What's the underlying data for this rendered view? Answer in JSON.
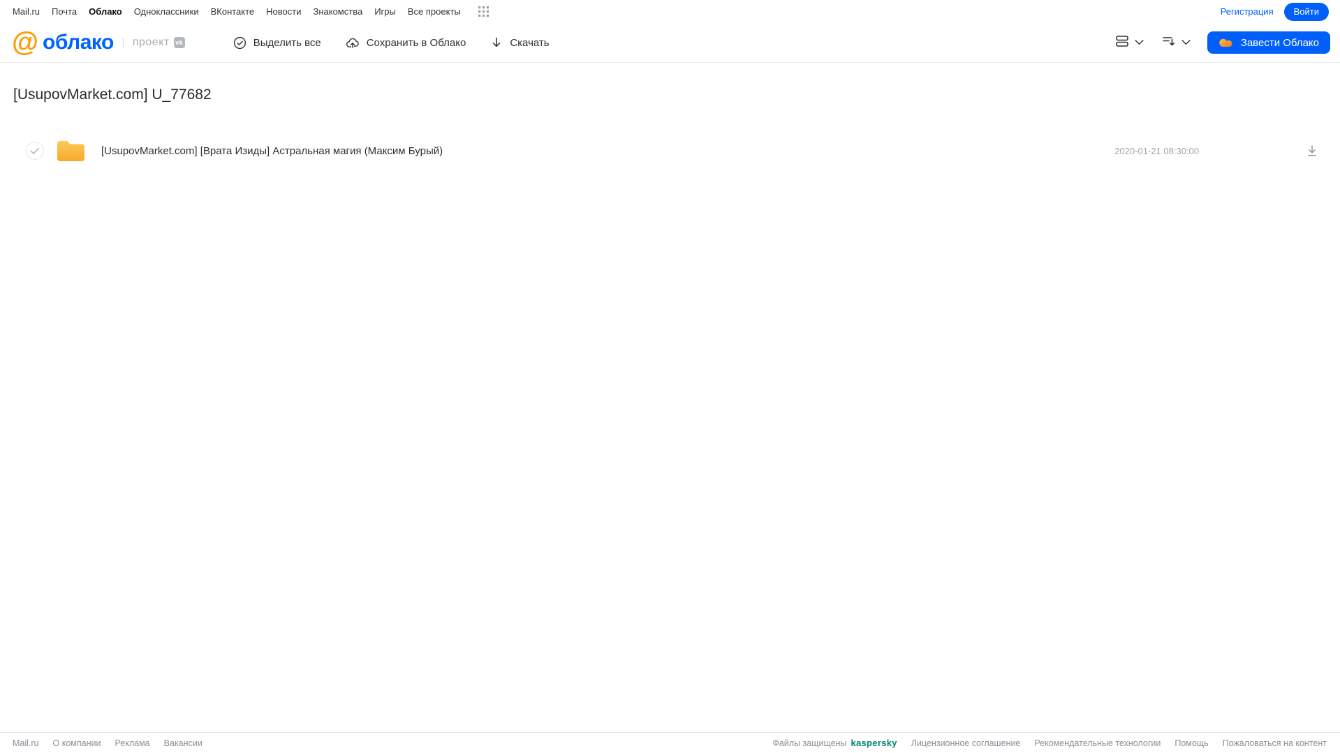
{
  "topnav": {
    "items": [
      "Mail.ru",
      "Почта",
      "Облако",
      "Одноклассники",
      "ВКонтакте",
      "Новости",
      "Знакомства",
      "Игры",
      "Все проекты"
    ],
    "active_item": "Облако",
    "registration": "Регистрация",
    "login": "Войти"
  },
  "header": {
    "logo_text": "облако",
    "project_label": "проект",
    "vk_badge": "vk",
    "toolbar": {
      "select_all": "Выделить все",
      "save_to_cloud": "Сохранить в Облако",
      "download": "Скачать"
    },
    "get_cloud_button": "Завести Облако"
  },
  "main": {
    "title": "[UsupovMarket.com] U_77682",
    "files": [
      {
        "type": "folder",
        "name": "[UsupovMarket.com] [Врата Изиды] Астральная магия (Максим Бурый)",
        "date": "2020-01-21 08:30:00"
      }
    ]
  },
  "footer": {
    "left_links": [
      "Mail.ru",
      "О компании",
      "Реклама",
      "Вакансии"
    ],
    "protected_label": "Файлы защищены",
    "kaspersky": "kaspersky",
    "right_links": [
      "Лицензионное соглашение",
      "Рекомендательные технологии",
      "Помощь",
      "Пожаловаться на контент"
    ]
  },
  "colors": {
    "accent_blue": "#005ff9",
    "logo_orange": "#ff9b04",
    "folder_yellow": "#fbbc40",
    "kaspersky_teal": "#00846d",
    "text_dark": "#2f3034",
    "text_gray": "#a5a5a5"
  }
}
